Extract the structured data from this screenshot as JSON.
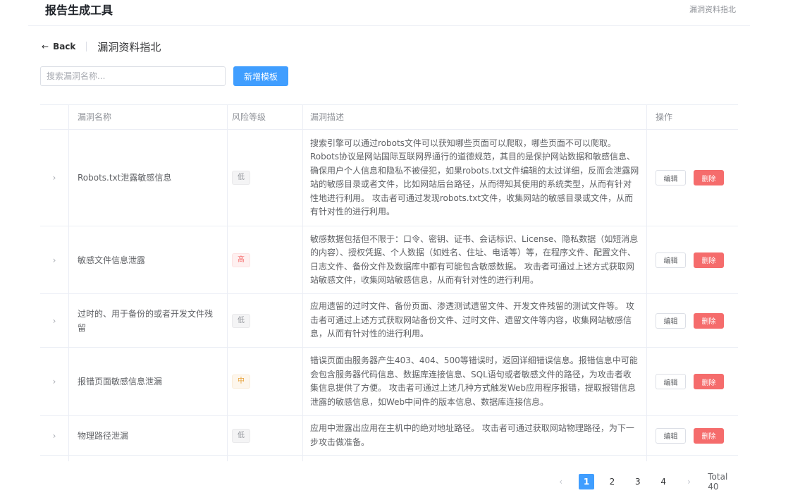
{
  "app": {
    "title": "报告生成工具",
    "top_crumb": "漏洞资料指北"
  },
  "header": {
    "back_label": "Back",
    "page_title": "漏洞资料指北"
  },
  "toolbar": {
    "search_placeholder": "搜索漏洞名称...",
    "add_label": "新增模板"
  },
  "table": {
    "columns": {
      "name": "漏洞名称",
      "risk": "风险等级",
      "desc": "漏洞描述",
      "action": "操作"
    },
    "edit_label": "编辑",
    "delete_label": "删除",
    "rows": [
      {
        "name": "Robots.txt泄露敏感信息",
        "risk": "低",
        "risk_level": "low",
        "desc": "搜索引擎可以通过robots文件可以获知哪些页面可以爬取，哪些页面不可以爬取。Robots协议是网站国际互联网界通行的道德规范，其目的是保护网站数据和敏感信息、确保用户个人信息和隐私不被侵犯，如果robots.txt文件编辑的太过详细，反而会泄露网站的敏感目录或者文件，比如网站后台路径，从而得知其使用的系统类型，从而有针对性地进行利用。 攻击者可通过发现robots.txt文件，收集网站的敏感目录或文件，从而有针对性的进行利用。"
      },
      {
        "name": "敏感文件信息泄露",
        "risk": "高",
        "risk_level": "high",
        "desc": "敏感数据包括但不限于：口令、密钥、证书、会话标识、License、隐私数据（如短消息的内容）、授权凭据、个人数据（如姓名、住址、电话等）等，在程序文件、配置文件、日志文件、备份文件及数据库中都有可能包含敏感数据。 攻击者可通过上述方式获取网站敏感文件，收集网站敏感信息，从而有针对性的进行利用。"
      },
      {
        "name": "过时的、用于备份的或者开发文件残留",
        "risk": "低",
        "risk_level": "low",
        "desc": "应用遗留的过时文件、备份页面、渗透测试遗留文件、开发文件残留的测试文件等。 攻击者可通过上述方式获取网站备份文件、过时文件、遗留文件等内容，收集网站敏感信息，从而有针对性的进行利用。"
      },
      {
        "name": "报错页面敏感信息泄漏",
        "risk": "中",
        "risk_level": "mid",
        "desc": "错误页面由服务器产生403、404、500等错误时，返回详细错误信息。报错信息中可能会包含服务器代码信息、数据库连接信息、SQL语句或者敏感文件的路径，为攻击者收集信息提供了方便。 攻击者可通过上述几种方式触发Web应用程序报错，提取报错信息泄露的敏感信息，如Web中间件的版本信息、数据库连接信息。"
      },
      {
        "name": "物理路径泄漏",
        "risk": "低",
        "risk_level": "low",
        "desc": "应用中泄露出应用在主机中的绝对地址路径。 攻击者可通过获取网站物理路径，为下一步攻击做准备。"
      }
    ]
  },
  "pagination": {
    "pages": [
      "1",
      "2",
      "3",
      "4"
    ],
    "current": "1",
    "total_label": "Total 40"
  },
  "colors": {
    "primary": "#409eff",
    "danger": "#f56c6c",
    "warning": "#e6a23c",
    "info": "#909399"
  }
}
